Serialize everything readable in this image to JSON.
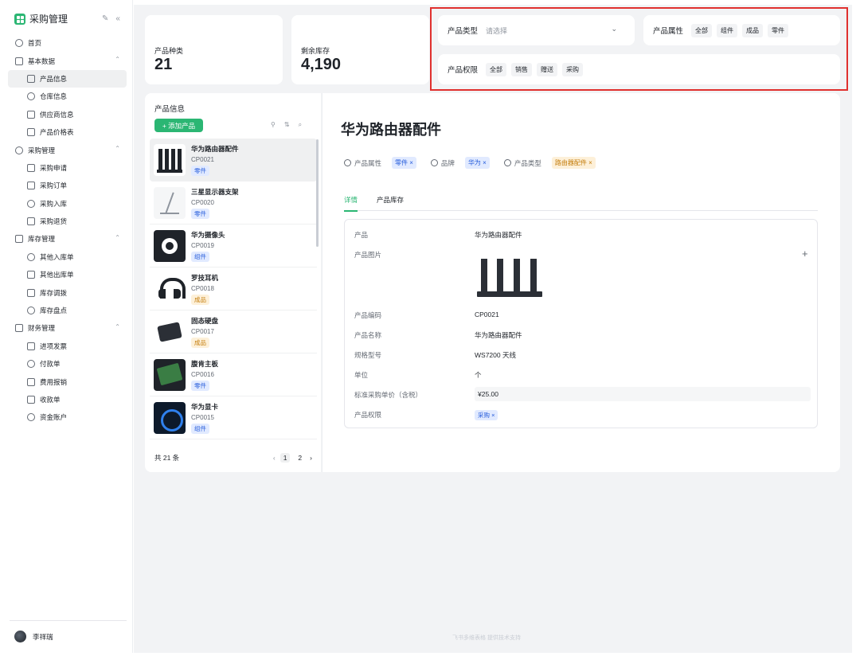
{
  "app": {
    "title": "采购管理",
    "edit_icon": "edit-icon",
    "collapse_icon": "collapse-icon"
  },
  "sidebar": {
    "items": [
      {
        "label": "首页",
        "icon": "home-icon",
        "child": false,
        "active": false
      },
      {
        "label": "基本数据",
        "icon": "layers-icon",
        "child": false,
        "active": false,
        "expanded": true
      },
      {
        "label": "产品信息",
        "icon": "globe-icon",
        "child": true,
        "active": true
      },
      {
        "label": "仓库信息",
        "icon": "warehouse-icon",
        "child": true,
        "active": false
      },
      {
        "label": "供应商信息",
        "icon": "monitor-icon",
        "child": true,
        "active": false
      },
      {
        "label": "产品价格表",
        "icon": "price-icon",
        "child": true,
        "active": false
      },
      {
        "label": "采购管理",
        "icon": "list-icon",
        "child": false,
        "active": false,
        "expanded": true
      },
      {
        "label": "采购申请",
        "icon": "mail-icon",
        "child": true,
        "active": false
      },
      {
        "label": "采购订单",
        "icon": "calendar-icon",
        "child": true,
        "active": false
      },
      {
        "label": "采购入库",
        "icon": "inbox-icon",
        "child": true,
        "active": false
      },
      {
        "label": "采购退货",
        "icon": "return-icon",
        "child": true,
        "active": false
      },
      {
        "label": "库存管理",
        "icon": "clock-icon",
        "child": false,
        "active": false,
        "expanded": true
      },
      {
        "label": "其他入库单",
        "icon": "doc-in-icon",
        "child": true,
        "active": false
      },
      {
        "label": "其他出库单",
        "icon": "bulb-icon",
        "child": true,
        "active": false
      },
      {
        "label": "库存调拨",
        "icon": "transfer-icon",
        "child": true,
        "active": false
      },
      {
        "label": "库存盘点",
        "icon": "settings-icon",
        "child": true,
        "active": false
      },
      {
        "label": "财务管理",
        "icon": "copy-icon",
        "child": false,
        "active": false,
        "expanded": true
      },
      {
        "label": "进项发票",
        "icon": "barcode-icon",
        "child": true,
        "active": false
      },
      {
        "label": "付款单",
        "icon": "chart-icon",
        "child": true,
        "active": false
      },
      {
        "label": "费用报销",
        "icon": "trophy-icon",
        "child": true,
        "active": false
      },
      {
        "label": "收款单",
        "icon": "lightbulb-icon",
        "child": true,
        "active": false
      },
      {
        "label": "资金账户",
        "icon": "bar-chart-icon",
        "child": true,
        "active": false
      }
    ],
    "user": {
      "name": "李祥瑞"
    }
  },
  "stats": [
    {
      "label": "产品种类",
      "value": "21"
    },
    {
      "label": "剩余库存",
      "value": "4,190"
    }
  ],
  "filters": {
    "product_type": {
      "label": "产品类型",
      "placeholder": "请选择"
    },
    "product_attr": {
      "label": "产品属性",
      "options": [
        "全部",
        "组件",
        "成品",
        "零件"
      ]
    },
    "product_perm": {
      "label": "产品权限",
      "options": [
        "全部",
        "销售",
        "赠送",
        "采购"
      ]
    }
  },
  "product_list": {
    "title": "产品信息",
    "add_label": "+ 添加产品",
    "items": [
      {
        "name": "华为路由器配件",
        "code": "CP0021",
        "tag": "零件",
        "tag_color": "blue",
        "thumb": "router"
      },
      {
        "name": "三星显示器支架",
        "code": "CP0020",
        "tag": "零件",
        "tag_color": "blue",
        "thumb": "stand"
      },
      {
        "name": "华为摄像头",
        "code": "CP0019",
        "tag": "组件",
        "tag_color": "blue",
        "thumb": "cam"
      },
      {
        "name": "罗技耳机",
        "code": "CP0018",
        "tag": "成品",
        "tag_color": "orange",
        "thumb": "headset"
      },
      {
        "name": "固态硬盘",
        "code": "CP0017",
        "tag": "成品",
        "tag_color": "orange",
        "thumb": "ssd"
      },
      {
        "name": "腹肯主板",
        "code": "CP0016",
        "tag": "零件",
        "tag_color": "blue",
        "thumb": "board"
      },
      {
        "name": "华为显卡",
        "code": "CP0015",
        "tag": "组件",
        "tag_color": "blue",
        "thumb": "gpu"
      }
    ],
    "total": "共 21 条",
    "pages": [
      "1",
      "2"
    ],
    "current_page": "1"
  },
  "detail": {
    "title": "华为路由器配件",
    "attrs": [
      {
        "label": "产品属性",
        "value": "零件 ×",
        "color": "blue"
      },
      {
        "label": "品牌",
        "value": "华为 ×",
        "color": "blue"
      },
      {
        "label": "产品类型",
        "value": "路由器配件 ×",
        "color": "orange"
      }
    ],
    "tabs": [
      "详情",
      "产品库存"
    ],
    "fields": {
      "product": {
        "key": "产品",
        "value": "华为路由器配件"
      },
      "image": {
        "key": "产品图片"
      },
      "code": {
        "key": "产品编码",
        "value": "CP0021"
      },
      "name": {
        "key": "产品名称",
        "value": "华为路由器配件"
      },
      "spec": {
        "key": "规格型号",
        "value": "WS7200 天线"
      },
      "unit": {
        "key": "单位",
        "value": "个"
      },
      "price": {
        "key": "标准采购单价（含税）",
        "value": "¥25.00"
      },
      "perm": {
        "key": "产品权限",
        "value": "采购 ×"
      }
    }
  },
  "footer": {
    "note": "飞书多维表格 提供技术支持"
  },
  "colors": {
    "accent": "#2bb673",
    "highlight_border": "#e0302e",
    "tag_blue": "#e1eaff",
    "tag_orange": "#fdf0d9"
  }
}
